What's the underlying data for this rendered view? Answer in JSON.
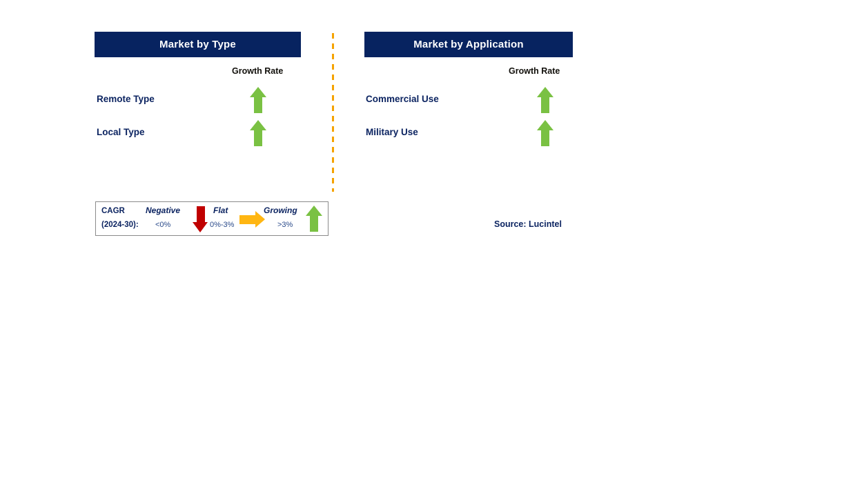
{
  "panels": [
    {
      "id": "market-by-type",
      "title": "Market by Type",
      "growth_rate_caption": "Growth Rate",
      "rows": [
        {
          "label": "Remote Type",
          "growth": "growing"
        },
        {
          "label": "Local Type",
          "growth": "growing"
        }
      ]
    },
    {
      "id": "market-by-application",
      "title": "Market by Application",
      "growth_rate_caption": "Growth Rate",
      "rows": [
        {
          "label": "Commercial Use",
          "growth": "growing"
        },
        {
          "label": "Military Use",
          "growth": "growing"
        }
      ]
    }
  ],
  "legend": {
    "title_line1": "CAGR",
    "title_line2": "(2024-30):",
    "items": [
      {
        "term": "Negative",
        "range": "<0%",
        "icon": "arrow-down-icon",
        "color": "#c00000"
      },
      {
        "term": "Flat",
        "range": "0%-3%",
        "icon": "arrow-right-icon",
        "color": "#ffb612"
      },
      {
        "term": "Growing",
        "range": ">3%",
        "icon": "arrow-up-icon",
        "color": "#7ac143"
      }
    ]
  },
  "source": "Source: Lucintel",
  "colors": {
    "header_navy": "#072360",
    "label_navy": "#0c2461",
    "growing_green": "#7ac143",
    "negative_red": "#c00000",
    "flat_yellow": "#ffb612",
    "divider_orange": "#f5a300"
  }
}
